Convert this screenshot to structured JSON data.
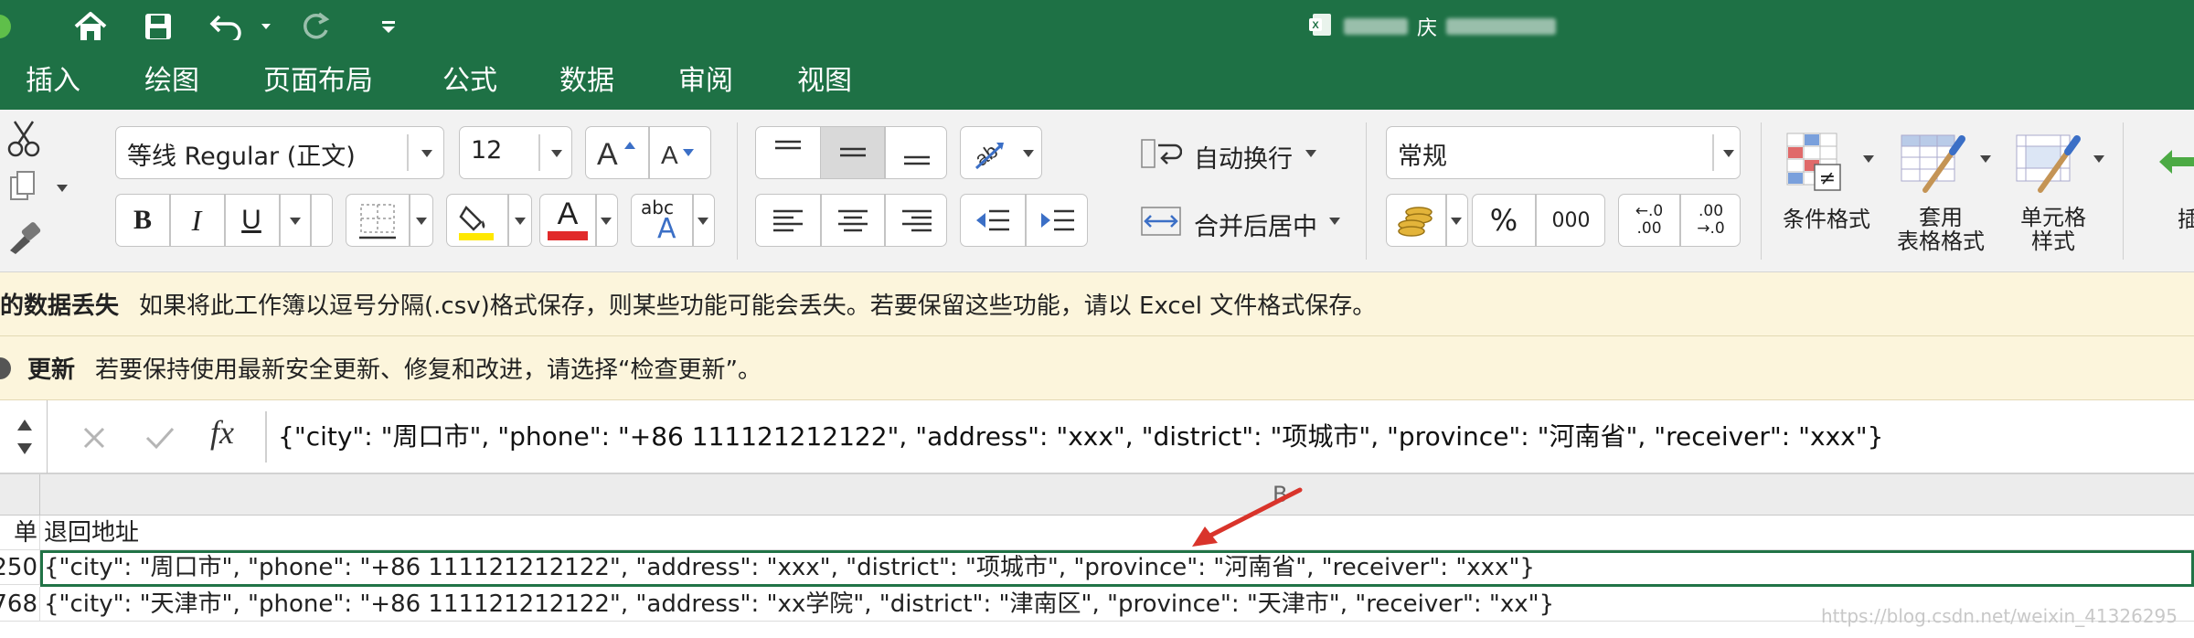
{
  "titlebar": {
    "icons": [
      "home-icon",
      "save-icon",
      "undo-icon",
      "redo-icon",
      "customize-toolbar-icon"
    ],
    "doc_title_visible": "庆",
    "file_icon": "excel-file-icon"
  },
  "tabs": [
    "插入",
    "绘图",
    "页面布局",
    "公式",
    "数据",
    "审阅",
    "视图"
  ],
  "ribbon": {
    "font_name": "等线 Regular (正文)",
    "font_size": "12",
    "bold": "B",
    "italic": "I",
    "underline": "U",
    "font_color_letter": "A",
    "font_color": "#e12a2a",
    "highlight_color": "#ffe800",
    "wrap_text": "自动换行",
    "merge_center": "合并后居中",
    "number_format": "常规",
    "percent": "%",
    "comma": "000",
    "increase_decimal_top": "←.0",
    "increase_decimal_bottom": ".00",
    "decrease_decimal_top": ".00",
    "decrease_decimal_bottom": "→.0",
    "conditional_format": "条件格式",
    "table_format_line1": "套用",
    "table_format_line2": "表格格式",
    "cell_style_line1": "单元格",
    "cell_style_line2": "样式",
    "insert_partial": "插",
    "abc_label": "abc",
    "abc_letter": "A"
  },
  "messages": {
    "csv_bold": "的数据丢失",
    "csv_text": "如果将此工作簿以逗号分隔(.csv)格式保存，则某些功能可能会丢失。若要保留这些功能，请以 Excel 文件格式保存。",
    "update_bold": "更新",
    "update_text": "若要保持使用最新安全更新、修复和改进，请选择“检查更新”。"
  },
  "formula_bar": {
    "fx": "fx",
    "value": "{\"city\": \"周口市\", \"phone\": \"+86 111121212122\", \"address\": \"xxx\", \"district\": \"项城市\", \"province\": \"河南省\", \"receiver\": \"xxx\"}"
  },
  "grid": {
    "column_b_header": "B",
    "rows": [
      {
        "a": "单",
        "b": "退回地址"
      },
      {
        "a": "250",
        "b": "{\"city\": \"周口市\", \"phone\": \"+86 111121212122\", \"address\": \"xxx\", \"district\": \"项城市\", \"province\": \"河南省\", \"receiver\": \"xxx\"}"
      },
      {
        "a": "768",
        "b": "{\"city\": \"天津市\", \"phone\": \"+86 111121212122\", \"address\": \"xx学院\", \"district\": \"津南区\", \"province\": \"天津市\", \"receiver\": \"xx\"}"
      }
    ],
    "watermark": "https://blog.csdn.net/weixin_41326295"
  },
  "colors": {
    "excel_green": "#1e7145",
    "selection_border": "#217346",
    "arrow_red": "#d9342b"
  }
}
